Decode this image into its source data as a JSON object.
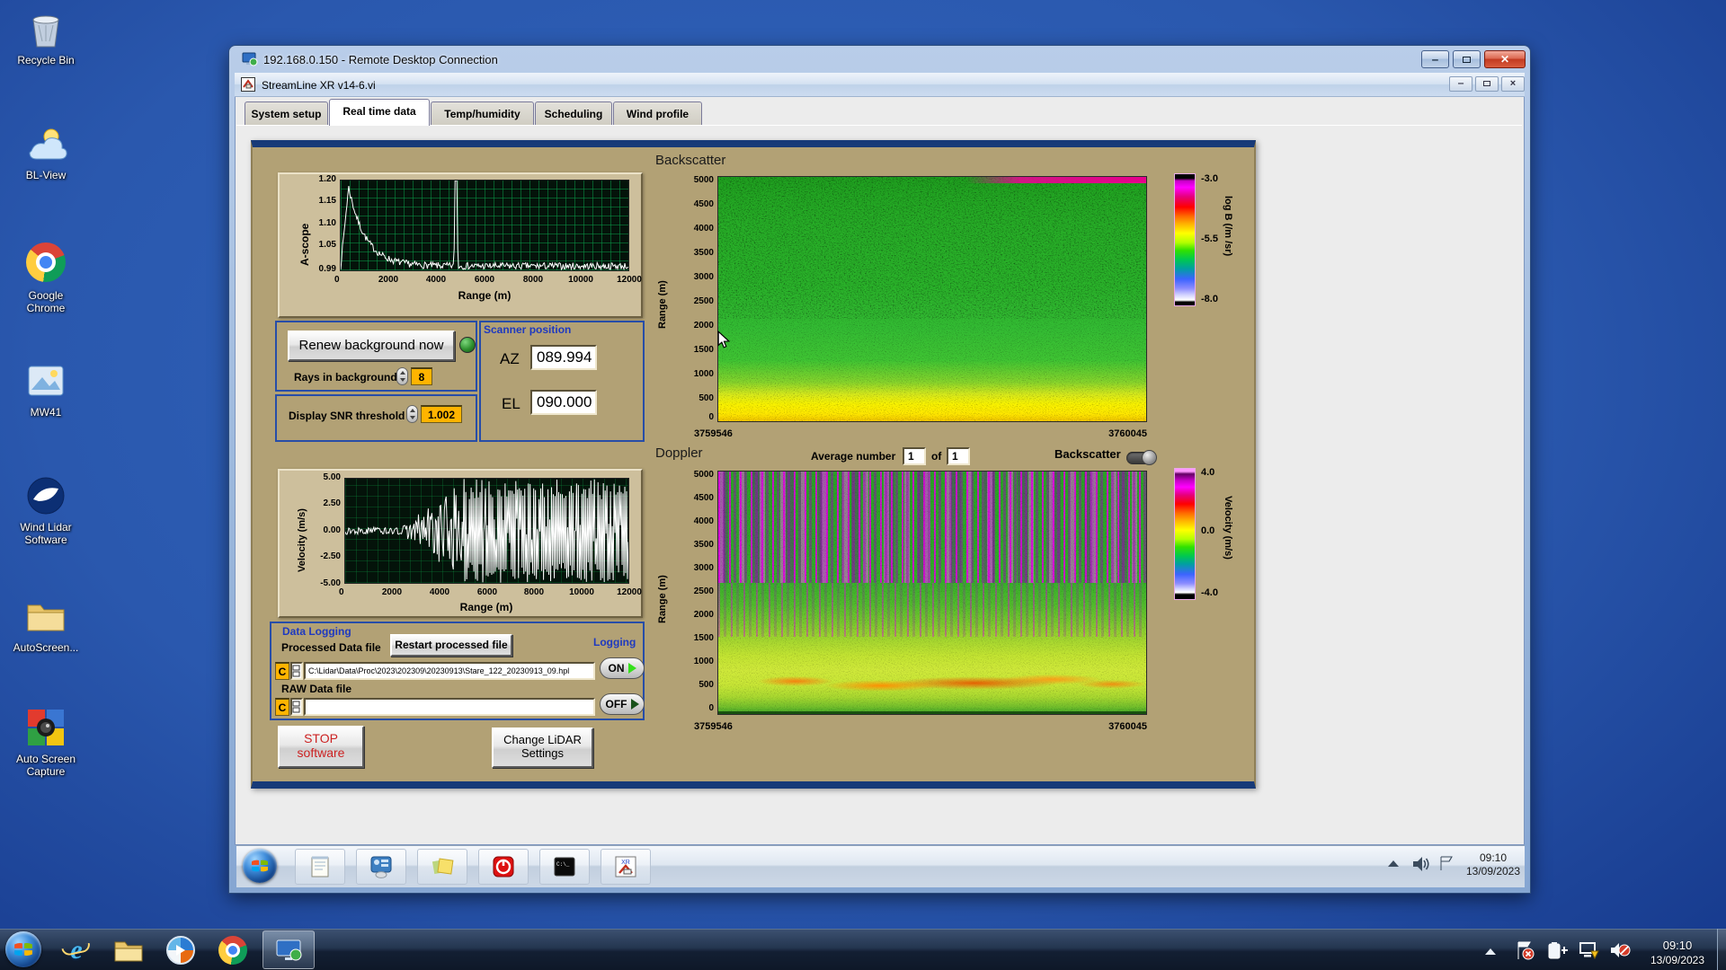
{
  "desktop": {
    "icons": [
      {
        "label": "Recycle Bin"
      },
      {
        "label": "BL-View"
      },
      {
        "label": "Google Chrome"
      },
      {
        "label": "MW41"
      },
      {
        "label": "Wind Lidar Software"
      },
      {
        "label": "AutoScreen..."
      },
      {
        "label": "Auto Screen Capture"
      }
    ]
  },
  "rdp": {
    "title": "192.168.0.150 - Remote Desktop Connection"
  },
  "app": {
    "title": "StreamLine XR v14-6.vi",
    "tabs": [
      {
        "label": "System setup"
      },
      {
        "label": "Real time data"
      },
      {
        "label": "Temp/humidity"
      },
      {
        "label": "Scheduling"
      },
      {
        "label": "Wind profile"
      }
    ]
  },
  "ascope": {
    "ylabel": "A-scope",
    "yticks": [
      "1.20",
      "1.15",
      "1.10",
      "1.05",
      "0.99"
    ],
    "xticks": [
      "0",
      "2000",
      "4000",
      "6000",
      "8000",
      "10000",
      "12000"
    ],
    "xlabel": "Range (m)"
  },
  "background_controls": {
    "renew_button": "Renew background now",
    "rays_label": "Rays in background",
    "rays_value": "8",
    "snr_label": "Display SNR threshold",
    "snr_value": "1.002"
  },
  "scanner": {
    "title": "Scanner position",
    "az_label": "AZ",
    "az_value": "089.994",
    "el_label": "EL",
    "el_value": "090.000"
  },
  "velocity": {
    "ylabel": "Velocity (m/s)",
    "yticks": [
      "5.00",
      "2.50",
      "0.00",
      "-2.50",
      "-5.00"
    ],
    "xticks": [
      "0",
      "2000",
      "4000",
      "6000",
      "8000",
      "10000",
      "12000"
    ],
    "xlabel": "Range (m)"
  },
  "backscatter": {
    "title": "Backscatter",
    "ylabel": "Range (m)",
    "yticks": [
      "5000",
      "4500",
      "4000",
      "3500",
      "3000",
      "2500",
      "2000",
      "1500",
      "1000",
      "500",
      "0"
    ],
    "x_start": "3759546",
    "x_end": "3760045",
    "colorbar": {
      "ticks": [
        "-3.0",
        "-5.5",
        "-8.0"
      ],
      "label": "log B (/m /sr)"
    }
  },
  "doppler": {
    "title": "Doppler",
    "avg_label": "Average number",
    "avg_value": "1",
    "of_label": "of",
    "count_value": "1",
    "toggle_label": "Backscatter",
    "ylabel": "Range (m)",
    "yticks": [
      "5000",
      "4500",
      "4000",
      "3500",
      "3000",
      "2500",
      "2000",
      "1500",
      "1000",
      "500",
      "0"
    ],
    "x_start": "3759546",
    "x_end": "3760045",
    "colorbar": {
      "ticks": [
        "4.0",
        "0.0",
        "-4.0"
      ],
      "label": "Velocity (m/s)"
    }
  },
  "data_logging": {
    "title": "Data Logging",
    "processed_label": "Processed Data file",
    "restart_button": "Restart processed file",
    "logging_label": "Logging",
    "drive": "C",
    "processed_path": "C:\\Lidar\\Data\\Proc\\2023\\202309\\20230913\\Stare_122_20230913_09.hpl",
    "on_label": "ON",
    "raw_label": "RAW Data file",
    "raw_path": "",
    "off_label": "OFF"
  },
  "footer_buttons": {
    "stop_line1": "STOP",
    "stop_line2": "software",
    "change_line1": "Change LiDAR",
    "change_line2": "Settings"
  },
  "remote_taskbar": {
    "time": "09:10",
    "date": "13/09/2023"
  },
  "host_taskbar": {
    "time": "09:10",
    "date": "13/09/2023"
  },
  "chart_data": [
    {
      "type": "line",
      "title": "A-scope",
      "xlabel": "Range (m)",
      "ylabel": "A-scope",
      "xlim": [
        0,
        12000
      ],
      "ylim": [
        0.99,
        1.2
      ],
      "peak": {
        "x": 330,
        "v": 1.185
      },
      "decay": 700,
      "base": 1.0,
      "noise": 0.008,
      "spike": {
        "x": 4800,
        "v": 1.21
      },
      "description": "white trace: sharp peak ~1.18 near 300 m decaying to ~1.0, narrow full-height spike at ~4800 m, flat noisy ~1.0 elsewhere"
    },
    {
      "type": "line",
      "title": "Velocity",
      "xlabel": "Range (m)",
      "ylabel": "Velocity (m/s)",
      "xlim": [
        0,
        12000
      ],
      "ylim": [
        -5,
        5
      ],
      "calm_until": 2400,
      "full_from": 5000,
      "calm_amp": 0.35,
      "description": "near-zero trace to ~2500 m, increasingly saturated ±5 m/s noise beyond ~3000 m"
    },
    {
      "type": "heatmap",
      "title": "Backscatter",
      "ylabel": "Range (m)",
      "ylim": [
        0,
        5000
      ],
      "x_range": [
        "3759546",
        "3760045"
      ],
      "colorbar": {
        "label": "log B (/m /sr)",
        "ticks": [
          -3.0,
          -5.5,
          -8.0
        ]
      },
      "description": "green speckled field aloft, bright yellow aerosol layer below ~500 m, magenta strip at 5000 m top-right"
    },
    {
      "type": "heatmap",
      "title": "Doppler",
      "ylabel": "Range (m)",
      "ylim": [
        0,
        5000
      ],
      "x_range": [
        "3759546",
        "3760045"
      ],
      "colorbar": {
        "label": "Velocity (m/s)",
        "ticks": [
          4.0,
          0.0,
          -4.0
        ]
      },
      "description": "magenta vertical noise streaks over green above ~2000 m, yellow-green boundary layer with orange patches near 500 m"
    }
  ]
}
